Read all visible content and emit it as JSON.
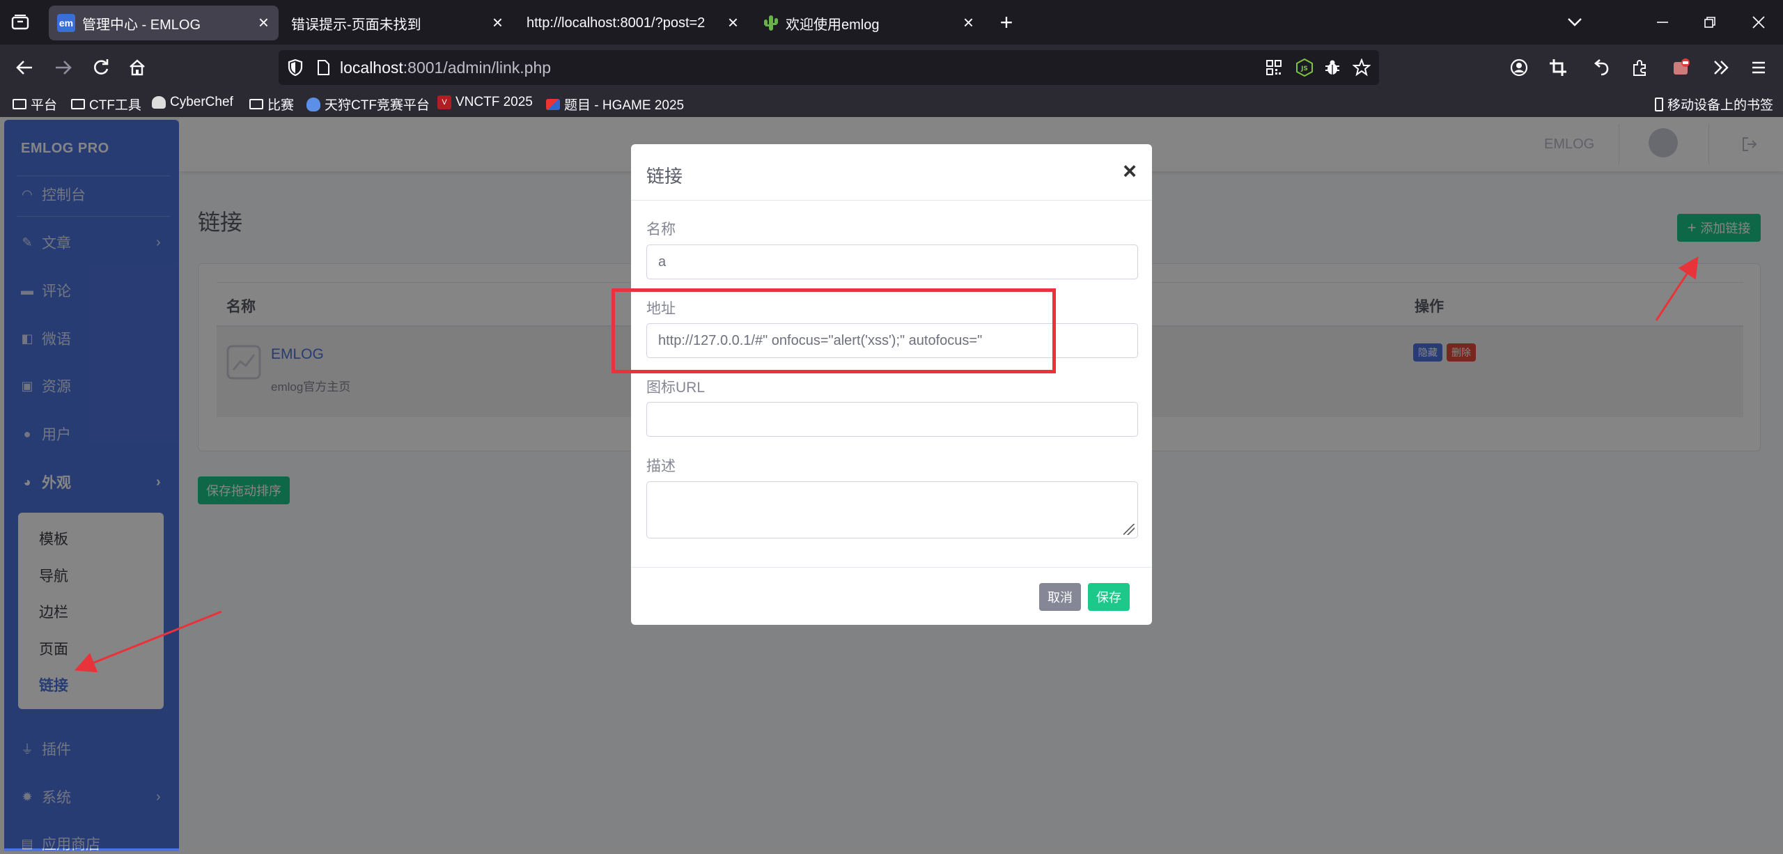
{
  "browser": {
    "tabs": [
      {
        "favicon": "em",
        "title": "管理中心 - EMLOG",
        "active": true
      },
      {
        "favicon": "",
        "title": "错误提示-页面未找到",
        "active": false
      },
      {
        "favicon": "",
        "title": "http://localhost:8001/?post=2",
        "active": false
      },
      {
        "favicon": "cactus",
        "title": "欢迎使用emlog",
        "active": false
      }
    ],
    "new_tab": "+",
    "url_host": "localhost",
    "url_rest": ":8001/admin/link.php",
    "bookmarks": [
      {
        "icon": "folder-icon",
        "label": "平台"
      },
      {
        "icon": "folder-icon",
        "label": "CTF工具"
      },
      {
        "icon": "chef-icon",
        "label": "CyberChef"
      },
      {
        "icon": "folder-icon",
        "label": "比赛"
      },
      {
        "icon": "dog-icon",
        "label": "天狩CTF竞赛平台"
      },
      {
        "icon": "vn-icon",
        "label": "VNCTF 2025"
      },
      {
        "icon": "hgame-icon",
        "label": "题目 - HGAME 2025"
      }
    ],
    "mobile_bookmarks": "移动设备上的书签"
  },
  "sidebar": {
    "brand": "EMLOG PRO",
    "items": [
      {
        "icon": "dashboard-icon",
        "label": "控制台",
        "chevron": false
      },
      {
        "icon": "pencil-icon",
        "label": "文章",
        "chevron": true
      },
      {
        "icon": "comment-icon",
        "label": "评论",
        "chevron": false
      },
      {
        "icon": "microblog-icon",
        "label": "微语",
        "chevron": false
      },
      {
        "icon": "image-icon",
        "label": "资源",
        "chevron": false
      },
      {
        "icon": "user-icon",
        "label": "用户",
        "chevron": false
      },
      {
        "icon": "palette-icon",
        "label": "外观",
        "chevron": true
      },
      {
        "icon": "plug-icon",
        "label": "插件",
        "chevron": false
      },
      {
        "icon": "gear-icon",
        "label": "系统",
        "chevron": true
      },
      {
        "icon": "store-icon",
        "label": "应用商店",
        "chevron": false
      }
    ],
    "appearance_submenu": [
      "模板",
      "导航",
      "边栏",
      "页面",
      "链接"
    ],
    "active_submenu": "链接"
  },
  "topbar": {
    "site": "EMLOG"
  },
  "main": {
    "title": "链接",
    "add_button": "添加链接",
    "table": {
      "headers": [
        "名称",
        "操作"
      ],
      "rows": [
        {
          "name": "EMLOG",
          "description": "emlog官方主页",
          "actions": [
            "隐藏",
            "删除"
          ]
        }
      ]
    },
    "save_order_button": "保存拖动排序"
  },
  "modal": {
    "title": "链接",
    "close": "×",
    "fields": {
      "name_label": "名称",
      "name_value": "a",
      "url_label": "地址",
      "url_value": "http://127.0.0.1/#\" onfocus=\"alert('xss');\" autofocus=\"",
      "icon_label": "图标URL",
      "icon_value": "",
      "desc_label": "描述",
      "desc_value": ""
    },
    "cancel_button": "取消",
    "save_button": "保存"
  },
  "colors": {
    "sidebar": "#4e73df",
    "success": "#1cc88a",
    "secondary": "#858796",
    "annotation_red": "#e8333a"
  }
}
